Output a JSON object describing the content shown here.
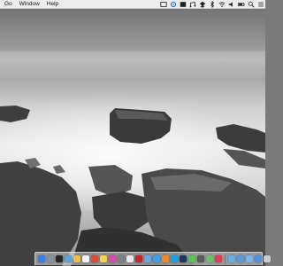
{
  "menubar": {
    "items": [
      "Go",
      "Window",
      "Help"
    ],
    "status_icons": [
      "screen-icon",
      "gear-icon",
      "display-icon",
      "audio-icon",
      "dropbox-icon",
      "bluetooth-icon",
      "wifi-icon",
      "volume-icon",
      "battery-icon",
      "search-icon",
      "list-icon"
    ]
  },
  "dock": {
    "apps_left": [
      {
        "icon": "finder-icon",
        "color": "#3b7de0"
      },
      {
        "icon": "launchpad-icon",
        "color": "#8a8f99"
      },
      {
        "icon": "terminal-icon",
        "color": "#2a2a2a"
      },
      {
        "icon": "mission-control-icon",
        "color": "#5ba3e0"
      },
      {
        "icon": "chrome-icon",
        "color": "#e8c04a"
      },
      {
        "icon": "textedit-icon",
        "color": "#f2f2f2"
      },
      {
        "icon": "calendar-icon",
        "color": "#e24b3b"
      },
      {
        "icon": "notes-icon",
        "color": "#f2d34e"
      },
      {
        "icon": "itunes-icon",
        "color": "#d94ab0"
      },
      {
        "icon": "system-preferences-icon",
        "color": "#7c8086"
      },
      {
        "icon": "photos-icon",
        "color": "#e8e8e8"
      },
      {
        "icon": "acrobat-icon",
        "color": "#c8242b"
      },
      {
        "icon": "mail-icon",
        "color": "#6ba7e8"
      },
      {
        "icon": "app-store-icon",
        "color": "#3aa0e8"
      },
      {
        "icon": "sublime-icon",
        "color": "#ef8a2c"
      },
      {
        "icon": "skype-icon",
        "color": "#1aa2e6"
      },
      {
        "icon": "photoshop-icon",
        "color": "#1e3a5f"
      },
      {
        "icon": "messages-icon",
        "color": "#58c455"
      },
      {
        "icon": "calculator-icon",
        "color": "#5b5b5b"
      },
      {
        "icon": "maps-icon",
        "color": "#6cc070"
      },
      {
        "icon": "music-icon",
        "color": "#e03c58"
      }
    ],
    "apps_right": [
      {
        "icon": "folder-icon",
        "color": "#6aaee8"
      },
      {
        "icon": "downloads-icon",
        "color": "#5a9be0"
      },
      {
        "icon": "documents-icon",
        "color": "#7ab4ea"
      },
      {
        "icon": "applications-icon",
        "color": "#4f92d8"
      },
      {
        "icon": "trash-icon",
        "color": "#c9ccd1"
      }
    ]
  }
}
